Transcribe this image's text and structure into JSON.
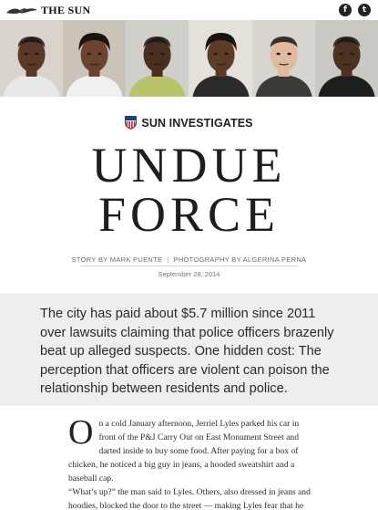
{
  "header": {
    "masthead": "THE SUN",
    "social": [
      {
        "icon": "facebook-icon",
        "glyph": "f"
      },
      {
        "icon": "twitter-icon",
        "glyph": "t"
      }
    ]
  },
  "photos": [
    {
      "skin": "#5a3a26",
      "bg": "#d8d4cc",
      "shirt": "#e8e8e8"
    },
    {
      "skin": "#6a4430",
      "bg": "#c9c3b8",
      "shirt": "#f0f0f0"
    },
    {
      "skin": "#4a2f20",
      "bg": "#cfd0ca",
      "shirt": "#b9c36a"
    },
    {
      "skin": "#5c3b27",
      "bg": "#e4e0da",
      "shirt": "#2a2a2a"
    },
    {
      "skin": "#e0b9a0",
      "bg": "#d7d5d0",
      "shirt": "#3a3a3a"
    },
    {
      "skin": "#4c3222",
      "bg": "#cbc9c4",
      "shirt": "#1e1e1e"
    }
  ],
  "badge": {
    "label": "SUN INVESTIGATES"
  },
  "headline": {
    "line1": "UNDUE",
    "line2": "FORCE"
  },
  "credits": {
    "story": "STORY BY MARK PUENTE",
    "separator": "|",
    "photography": "PHOTOGRAPHY BY ALGERINA PERNA",
    "date": "September 28, 2014"
  },
  "summary": "The city has paid about $5.7 million since 2011 over lawsuits claiming that police officers brazenly beat up alleged suspects. One hidden cost: The perception that officers are violent can poison the relationship between residents and police.",
  "article": {
    "dropcap": "O",
    "p1_rest": "n a cold January afternoon, Jerriel Lyles parked his car in front of the P&J Carry Out on East Monument Street and darted inside to buy some food. After paying for a box of chicken, he noticed a big guy in jeans, a hooded sweatshirt and a baseball cap.",
    "p2": "“What’s up?” the man said to Lyles. Others, also dressed in jeans and hoodies, blocked the door to the street — making Lyles fear that he"
  },
  "colors": {
    "summary_bg": "#eeeeee",
    "shield_red": "#c8202f",
    "shield_blue": "#24407a"
  }
}
